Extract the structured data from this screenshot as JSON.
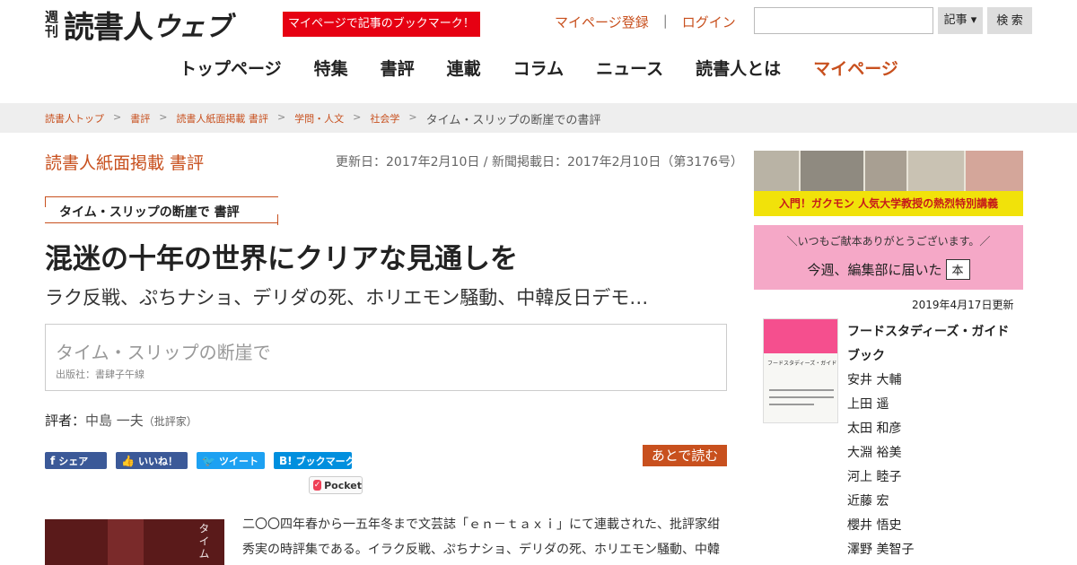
{
  "header": {
    "logo_small_top": "週",
    "logo_small_bottom": "刊",
    "logo_main": "読書人",
    "logo_sub": "ウェブ",
    "promo": "マイページで記事のブックマーク！",
    "register": "マイページ登録",
    "separator": "|",
    "login": "ログイン",
    "search_select": "記事 ▾",
    "search_button": "検 索"
  },
  "nav": [
    "トップページ",
    "特集",
    "書評",
    "連載",
    "コラム",
    "ニュース",
    "読書人とは",
    "マイページ"
  ],
  "breadcrumb": {
    "links": [
      "読書人トップ",
      "書評",
      "読書人紙面掲載 書評",
      "学問・人文",
      "社会学"
    ],
    "current": "タイム・スリップの断崖での書評",
    "arrow": ">"
  },
  "article": {
    "section": "読書人紙面掲載 書評",
    "dates": "更新日：2017年2月10日 / 新聞掲載日：2017年2月10日（第3176号）",
    "tag": "タイム・スリップの断崖で 書評",
    "headline": "混迷の十年の世界にクリアな見通しを",
    "subhead": "ラク反戦、ぷちナショ、デリダの死、ホリエモン騒動、中韓反日デモ…",
    "book_title": "タイム・スリップの断崖で",
    "publisher": "出版社：書肆子午線",
    "reviewer_label": "評者：",
    "reviewer_name": "中島 一夫",
    "reviewer_role": "（批評家）",
    "later": "あとで読む",
    "cover_text": "タイム",
    "body_line1": "二〇〇四年春から一五年冬まで文芸誌「ｅｎ－ｔａｘｉ」にて連載された、批評家绀",
    "body_line2": "秀実の時評集である。イラク反戦、ぷちナショ、デリダの死、ホリエモン騒動、中韓"
  },
  "share": {
    "facebook": "シェア",
    "facebook_glyph": "f",
    "like": "いいね！",
    "like_glyph": "👍",
    "tweet": "ツイート",
    "tweet_glyph": "🐦",
    "hatena": "ブックマーク",
    "hatena_glyph": "B!",
    "pocket": "Pocket",
    "pocket_glyph": "✓"
  },
  "sidebar": {
    "banner1_caption": "入門！ガクモン 人気大学教授の熱烈特別講義",
    "banner2_top": "＼いつもご献本ありがとうございます。／",
    "banner2_main": "今週、編集部に届いた",
    "banner2_book": "本",
    "date": "2019年4月17日更新",
    "cover_title": "フードスタディーズ・ガイドブック",
    "book_title": "フードスタディーズ・ガイドブック",
    "authors": [
      "安井 大輔",
      "上田 遥",
      "太田 和彦",
      "大淵 裕美",
      "河上 睦子",
      "近藤 宏",
      "櫻井 悟史",
      "澤野 美智子"
    ]
  },
  "colors": {
    "accent": "#c8501e",
    "promo_red": "#e60012",
    "facebook": "#3b5998",
    "twitter": "#1da1f2",
    "hatena": "#008fde",
    "pink_banner": "#f5a8c7"
  }
}
